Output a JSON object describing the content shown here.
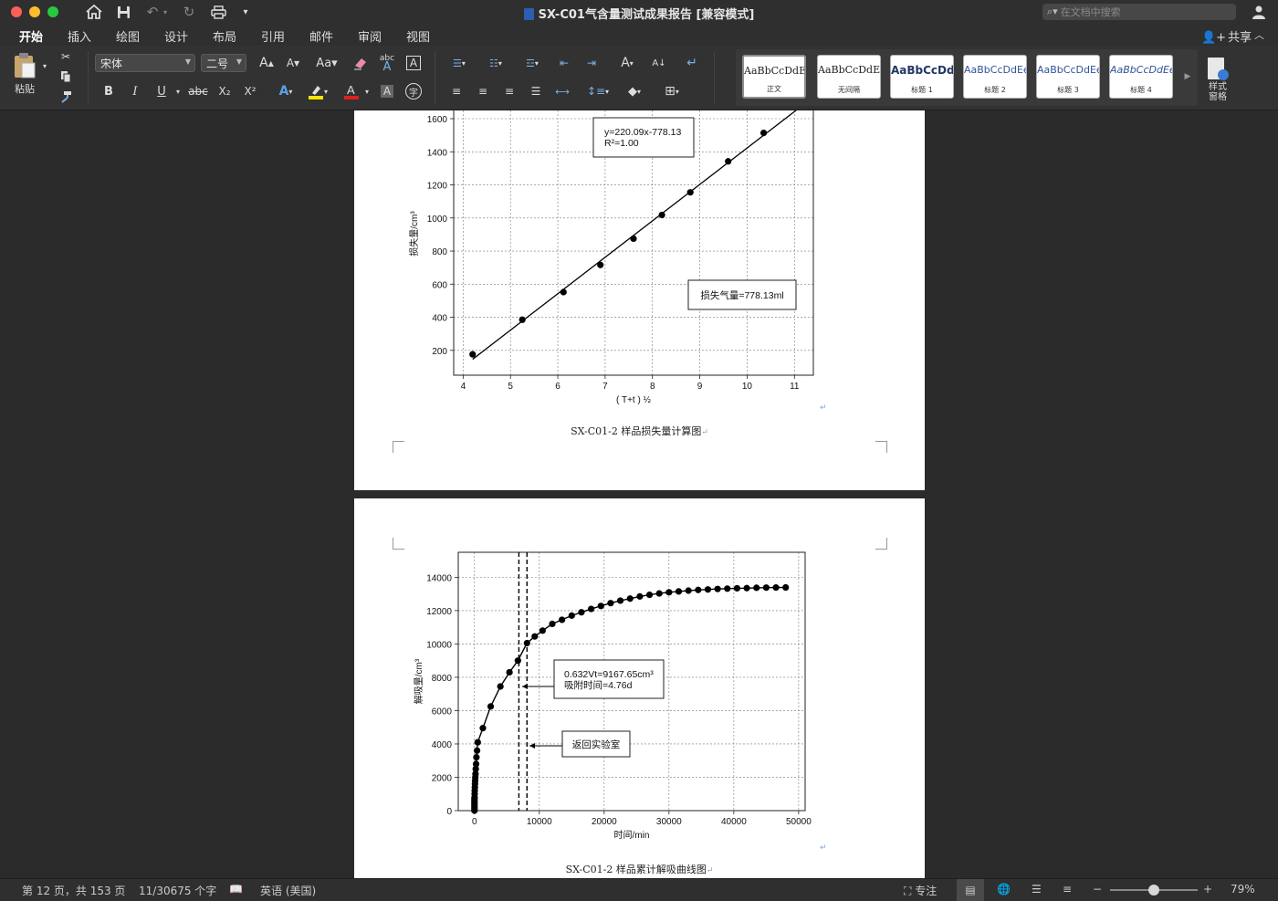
{
  "window": {
    "title": "SX-C01气含量测试成果报告 [兼容模式]"
  },
  "search": {
    "placeholder": "在文档中搜索"
  },
  "menu": {
    "tabs": [
      "开始",
      "插入",
      "绘图",
      "设计",
      "布局",
      "引用",
      "邮件",
      "审阅",
      "视图"
    ],
    "active": "开始",
    "share_label": "共享"
  },
  "ribbon": {
    "paste_label": "粘贴",
    "font_name": "宋体",
    "font_size": "二号",
    "bold": "B",
    "italic": "I",
    "underline": "U",
    "strike": "abc",
    "subscript": "X₂",
    "superscript": "X²",
    "styles": [
      {
        "sample": "AaBbCcDdEe",
        "name": "正文"
      },
      {
        "sample": "AaBbCcDdEe",
        "name": "无间隔"
      },
      {
        "sample": "AaBbCcDdI",
        "name": "标题 1"
      },
      {
        "sample": "AaBbCcDdEe",
        "name": "标题 2"
      },
      {
        "sample": "AaBbCcDdEe",
        "name": "标题 3"
      },
      {
        "sample": "AaBbCcDdEe",
        "name": "标题 4"
      }
    ],
    "styles_pane_label": "样式\n窗格",
    "colors": {
      "highlight": "#f5e500",
      "font_color": "#e02020"
    }
  },
  "document": {
    "caption1": "SX-C01-2 样品损失量计算图",
    "caption2": "SX-C01-2 样品累计解吸曲线图"
  },
  "chart_data": [
    {
      "type": "scatter",
      "title": "",
      "xlabel": "( T+t ) ½",
      "ylabel": "损失量/cm³",
      "xlim": [
        3.8,
        11.4
      ],
      "ylim": [
        50,
        1760
      ],
      "xticks": [
        4,
        5,
        6,
        7,
        8,
        9,
        10,
        11
      ],
      "yticks": [
        200,
        400,
        600,
        800,
        1000,
        1200,
        1400,
        1600
      ],
      "grid": true,
      "series": [
        {
          "x": [
            4.2,
            5.25,
            6.12,
            6.9,
            7.6,
            8.2,
            8.8,
            9.6,
            10.35,
            11.07
          ],
          "y": [
            176,
            385,
            552,
            716,
            875,
            1018,
            1155,
            1342,
            1514,
            1680
          ]
        }
      ],
      "trendline": {
        "slope": 220.09,
        "intercept": -778.13
      },
      "annotations": [
        "y=220.09x-778.13",
        "R²=1.00",
        "损失气量=778.13ml"
      ]
    },
    {
      "type": "line",
      "title": "",
      "xlabel": "时间/min",
      "ylabel": "解吸量/cm³",
      "xlim": [
        -2500,
        51000
      ],
      "ylim": [
        0,
        15500
      ],
      "xticks": [
        0,
        10000,
        20000,
        30000,
        40000,
        50000
      ],
      "yticks": [
        0,
        2000,
        4000,
        6000,
        8000,
        10000,
        12000,
        14000
      ],
      "grid": true,
      "series": [
        {
          "x": [
            0,
            0,
            0,
            0,
            0,
            0,
            0,
            0,
            20,
            30,
            40,
            60,
            80,
            100,
            130,
            160,
            200,
            250,
            300,
            400,
            500,
            1300,
            2500,
            4000,
            5400,
            6700,
            8100,
            9300,
            10500,
            12000,
            13500,
            15000,
            16500,
            18000,
            19500,
            21000,
            22500,
            24000,
            25500,
            27000,
            28500,
            30000,
            31500,
            33000,
            34500,
            36000,
            37500,
            39000,
            40500,
            42000,
            43500,
            45000,
            46500,
            48000
          ],
          "y": [
            0,
            100,
            200,
            300,
            400,
            500,
            600,
            700,
            800,
            1000,
            1200,
            1400,
            1600,
            1800,
            2000,
            2200,
            2500,
            2800,
            3200,
            3600,
            4100,
            4950,
            6250,
            7450,
            8300,
            9000,
            10050,
            10450,
            10800,
            11200,
            11450,
            11700,
            11900,
            12100,
            12280,
            12450,
            12600,
            12720,
            12850,
            12950,
            13030,
            13100,
            13150,
            13200,
            13240,
            13270,
            13300,
            13320,
            13340,
            13350,
            13370,
            13380,
            13385,
            13390
          ]
        }
      ],
      "vlines": [
        6850,
        8100
      ],
      "annotations": [
        "0.632Vt=9167.65cm³",
        "吸附时间=4.76d",
        "返回实验室"
      ]
    }
  ],
  "status": {
    "page": "第 12 页，共 153 页",
    "words": "11/30675 个字",
    "language": "英语 (美国)",
    "focus": "专注",
    "zoom": "79%",
    "zoom_level": 0.5
  }
}
